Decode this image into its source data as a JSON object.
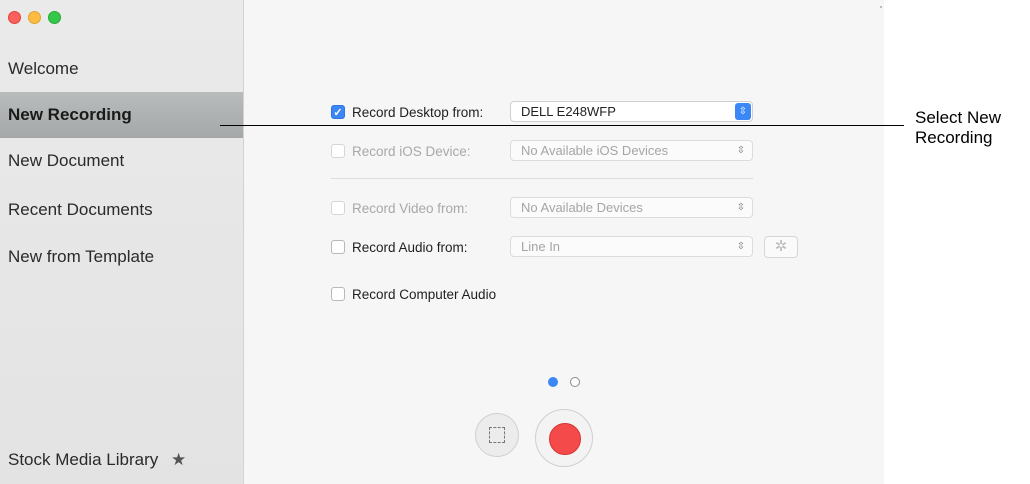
{
  "sidebar": {
    "items": [
      {
        "label": "Welcome",
        "selected": false
      },
      {
        "label": "New Recording",
        "selected": true
      },
      {
        "label": "New Document",
        "selected": false
      },
      {
        "label": "Recent Documents",
        "selected": false
      },
      {
        "label": "New from Template",
        "selected": false
      }
    ],
    "stock_library": {
      "label": "Stock Media Library",
      "icon": "star-icon"
    }
  },
  "recording": {
    "desktop": {
      "label": "Record Desktop from:",
      "checked": true,
      "enabled": true,
      "value": "DELL E248WFP"
    },
    "ios": {
      "label": "Record iOS Device:",
      "checked": false,
      "enabled": false,
      "value": "No Available iOS Devices"
    },
    "video": {
      "label": "Record Video from:",
      "checked": false,
      "enabled": false,
      "value": "No Available Devices"
    },
    "audio": {
      "label": "Record Audio from:",
      "checked": false,
      "enabled": true,
      "value": "Line In"
    },
    "computer_audio": {
      "label": "Record Computer Audio",
      "checked": false,
      "enabled": true
    }
  },
  "icons": {
    "checkmark": "✓",
    "updown": "⌃⌄",
    "gear": "✲",
    "star": "★"
  },
  "pager": {
    "current": 1,
    "total": 2
  },
  "callout": {
    "text": "Select New Recording"
  },
  "colors": {
    "accent": "#3b87f5",
    "record": "#f44a4a"
  }
}
